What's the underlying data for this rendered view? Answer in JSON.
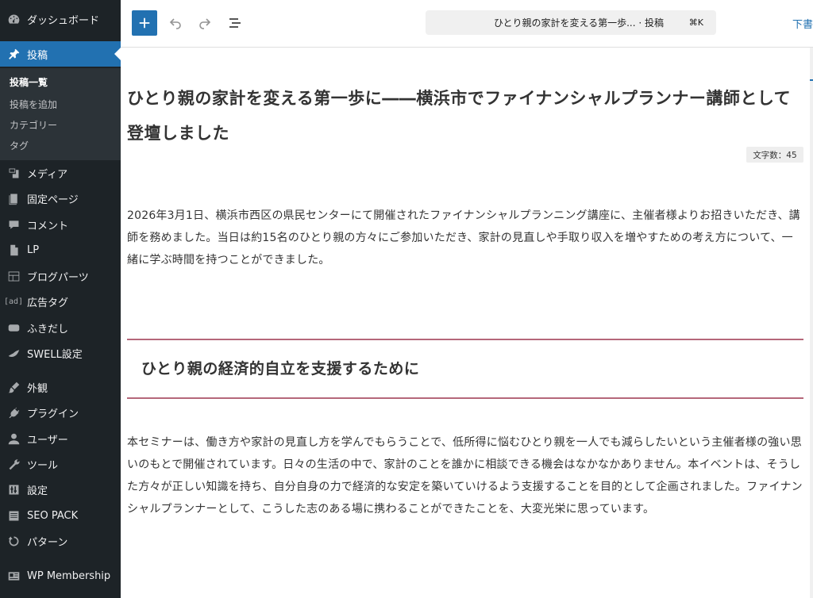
{
  "sidebar": {
    "menu": [
      {
        "id": "dashboard",
        "label": "ダッシュボード",
        "icon": "dashboard-icon"
      },
      {
        "id": "posts",
        "label": "投稿",
        "icon": "pin-icon",
        "active": true
      },
      {
        "id": "media",
        "label": "メディア",
        "icon": "media-icon"
      },
      {
        "id": "pages",
        "label": "固定ページ",
        "icon": "page-icon"
      },
      {
        "id": "comments",
        "label": "コメント",
        "icon": "comment-icon"
      },
      {
        "id": "lp",
        "label": "LP",
        "icon": "document-icon"
      },
      {
        "id": "blog-parts",
        "label": "ブログパーツ",
        "icon": "layout-icon"
      },
      {
        "id": "ad-tag",
        "label": "広告タグ",
        "icon": "ad-icon",
        "icon_text": "[ad]"
      },
      {
        "id": "fukidashi",
        "label": "ふきだし",
        "icon": "speech-bubble-icon"
      },
      {
        "id": "swell-settings",
        "label": "SWELL設定",
        "icon": "swell-icon"
      },
      {
        "id": "appearance",
        "label": "外観",
        "icon": "brush-icon"
      },
      {
        "id": "plugins",
        "label": "プラグイン",
        "icon": "plugin-icon"
      },
      {
        "id": "users",
        "label": "ユーザー",
        "icon": "user-icon"
      },
      {
        "id": "tools",
        "label": "ツール",
        "icon": "wrench-icon"
      },
      {
        "id": "settings",
        "label": "設定",
        "icon": "settings-icon"
      },
      {
        "id": "seo-pack",
        "label": "SEO PACK",
        "icon": "list-icon"
      },
      {
        "id": "patterns",
        "label": "パターン",
        "icon": "refresh-icon"
      },
      {
        "id": "wp-membership",
        "label": "WP Membership",
        "icon": "membership-icon"
      }
    ],
    "submenu": [
      {
        "label": "投稿一覧",
        "current": true
      },
      {
        "label": "投稿を追加"
      },
      {
        "label": "カテゴリー"
      },
      {
        "label": "タグ"
      }
    ]
  },
  "toolbar": {
    "command_title": "ひとり親の家計を変える第一歩... · 投稿",
    "command_shortcut": "⌘K",
    "draft_label": "下書"
  },
  "post": {
    "title": "ひとり親の家計を変える第一歩に――横浜市でファイナンシャルプランナー講師として登壇しました",
    "char_count": "文字数：45",
    "paragraph1": "2026年3月1日、横浜市西区の県民センターにて開催されたファイナンシャルプランニング講座に、主催者様よりお招きいただき、講師を務めました。当日は約15名のひとり親の方々にご参加いただき、家計の見直しや手取り収入を増やすための考え方について、一緒に学ぶ時間を持つことができました。",
    "heading2": "ひとり親の経済的自立を支援するために",
    "paragraph2": "本セミナーは、働き方や家計の見直し方を学んでもらうことで、低所得に悩むひとり親を一人でも減らしたいという主催者様の強い思いのもとで開催されています。日々の生活の中で、家計のことを誰かに相談できる機会はなかなかありません。本イベントは、そうした方々が正しい知識を持ち、自分自身の力で経済的な安定を築いていけるよう支援することを目的として企画されました。ファイナンシャルプランナーとして、こうした志のある場に携わることができたことを、大変光栄に思っています。"
  },
  "colors": {
    "sidebar_bg": "#1d2327",
    "accent": "#2271b1",
    "heading_line": "#b5677a"
  }
}
